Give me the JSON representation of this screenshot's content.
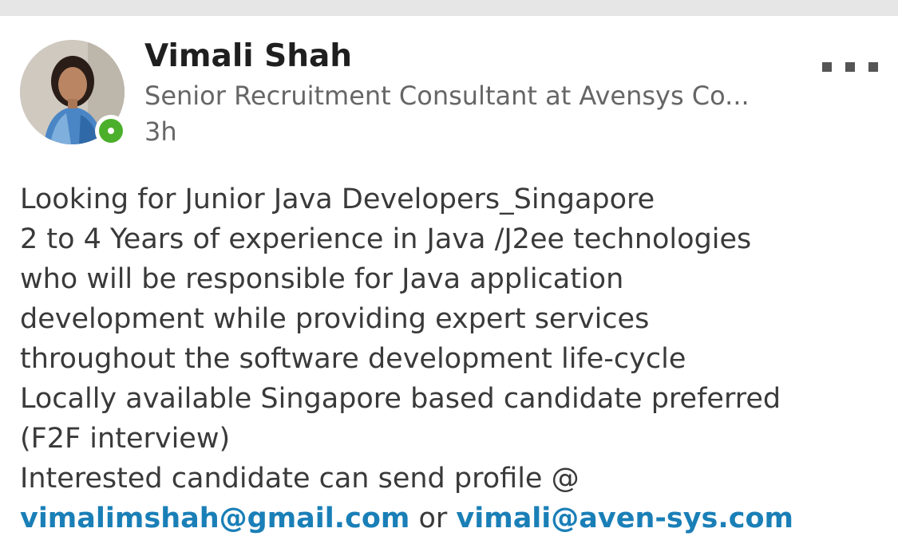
{
  "post": {
    "author": {
      "name": "Vimali Shah",
      "headline": "Senior Recruitment Consultant at Avensys Co...",
      "time": "3h",
      "presence": "online",
      "avatar_icon": "profile-photo"
    },
    "menu_icon": "more-options-icon",
    "lines": [
      "Looking for Junior Java Developers_Singapore",
      "2 to 4 Years of experience in Java /J2ee technologies",
      "who will be responsible for Java application",
      "development while providing expert services",
      "throughout the software development life-cycle",
      "Locally available Singapore based candidate preferred",
      "(F2F interview)",
      "Interested candidate can send profile @"
    ],
    "contact": {
      "email1": "vimalimshah@gmail.com",
      "separator": " or ",
      "email2": "vimali@aven-sys.com"
    }
  },
  "colors": {
    "link": "#1a7fb7",
    "presence": "#4caf2b",
    "text": "#3a3a3a",
    "muted": "#666666"
  }
}
